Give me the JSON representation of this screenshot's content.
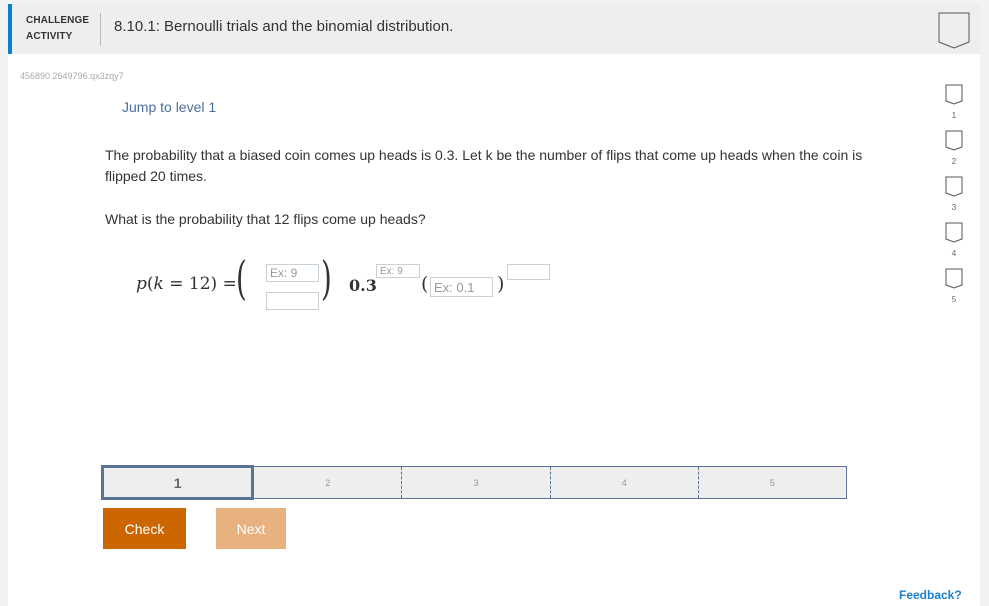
{
  "header": {
    "label_line1": "CHALLENGE",
    "label_line2": "ACTIVITY",
    "title": "8.10.1: Bernoulli trials and the binomial distribution.",
    "accent_color": "#0b80d0"
  },
  "activity_code": "456890.2649796.qx3zqy7",
  "jump_link": "Jump to level 1",
  "prompt": "The probability that a biased coin comes up heads is 0.3. Let k be the number of flips that come up heads when the coin is flipped 20 times.",
  "question": "What is the probability that 12 flips come up heads?",
  "equation": {
    "lhs": "p(k = 12) =",
    "base": "0.3",
    "open_paren": "(",
    "close_paren": ")",
    "inputs": {
      "binom_top": {
        "value": "",
        "placeholder": "Ex: 9"
      },
      "binom_bottom": {
        "value": "",
        "placeholder": ""
      },
      "exponent1": {
        "value": "",
        "placeholder": "Ex: 9"
      },
      "base2": {
        "value": "",
        "placeholder": "Ex: 0.1"
      },
      "exponent2": {
        "value": "",
        "placeholder": ""
      }
    }
  },
  "levels": {
    "items": [
      "1",
      "2",
      "3",
      "4",
      "5"
    ],
    "active": "1",
    "border_color": "#5a7394"
  },
  "buttons": {
    "check": "Check",
    "next": "Next",
    "check_color": "#cc6600",
    "next_color": "#e7b280"
  },
  "progress_levels": [
    "1",
    "2",
    "3",
    "4",
    "5"
  ],
  "feedback": "Feedback?"
}
